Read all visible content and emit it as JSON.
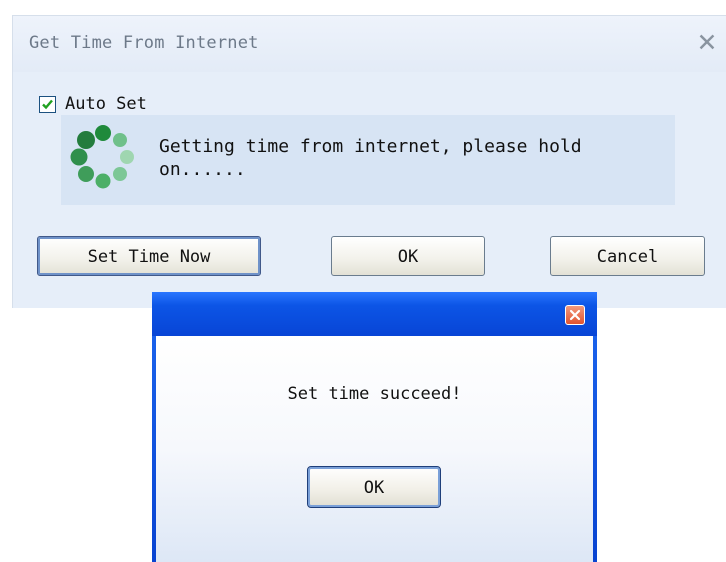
{
  "main_dialog": {
    "title": "Get Time From Internet",
    "close_icon": "close-icon",
    "auto_checkbox": {
      "label": "Auto Set",
      "checked": true
    },
    "progress": {
      "message": "Getting time from internet, please hold on......",
      "icon": "loading-spinner-icon"
    },
    "buttons": {
      "set_time_now": "Set Time Now",
      "ok": "OK",
      "cancel": "Cancel"
    }
  },
  "message_box": {
    "title": "",
    "close_icon": "close-icon",
    "message": "Set time succeed!",
    "ok_label": "OK"
  },
  "colors": {
    "dialog_bg": "#e6eef9",
    "progress_bg": "#d7e4f4",
    "msgbox_titlebar": "#0a50e0",
    "spinner_green": "#2e9e4c",
    "close_red": "#e2532f"
  }
}
